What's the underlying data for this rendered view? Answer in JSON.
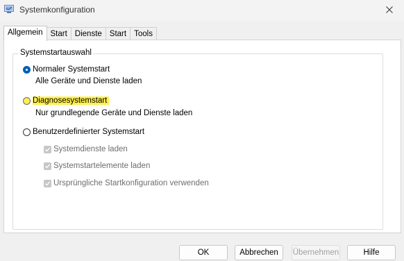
{
  "window": {
    "title": "Systemkonfiguration",
    "close_icon": "close-icon",
    "app_icon": "system-configuration-icon"
  },
  "tabs": [
    {
      "label": "Allgemein",
      "active": true
    },
    {
      "label": "Start",
      "active": false
    },
    {
      "label": "Dienste",
      "active": false
    },
    {
      "label": "Start",
      "active": false
    },
    {
      "label": "Tools",
      "active": false
    }
  ],
  "group": {
    "legend": "Systemstartauswahl",
    "options": [
      {
        "label": "Normaler Systemstart",
        "description": "Alle Geräte und Dienste laden",
        "selected": true
      },
      {
        "label": "Diagnosesystemstart",
        "description": "Nur grundlegende Geräte und Dienste laden",
        "selected": false,
        "highlighted": true
      },
      {
        "label": "Benutzerdefinierter Systemstart",
        "selected": false
      }
    ],
    "checkboxes": [
      {
        "label": "Systemdienste laden",
        "checked": true,
        "disabled": true
      },
      {
        "label": "Systemstartelemente laden",
        "checked": true,
        "disabled": true
      },
      {
        "label": "Ursprüngliche Startkonfiguration verwenden",
        "checked": true,
        "disabled": true
      }
    ]
  },
  "buttons": {
    "ok": "OK",
    "cancel": "Abbrechen",
    "apply": "Übernehmen",
    "help": "Hilfe"
  },
  "colors": {
    "accent": "#005fb8",
    "highlight": "#fff04a",
    "disabled_text": "#6d6d6d"
  }
}
